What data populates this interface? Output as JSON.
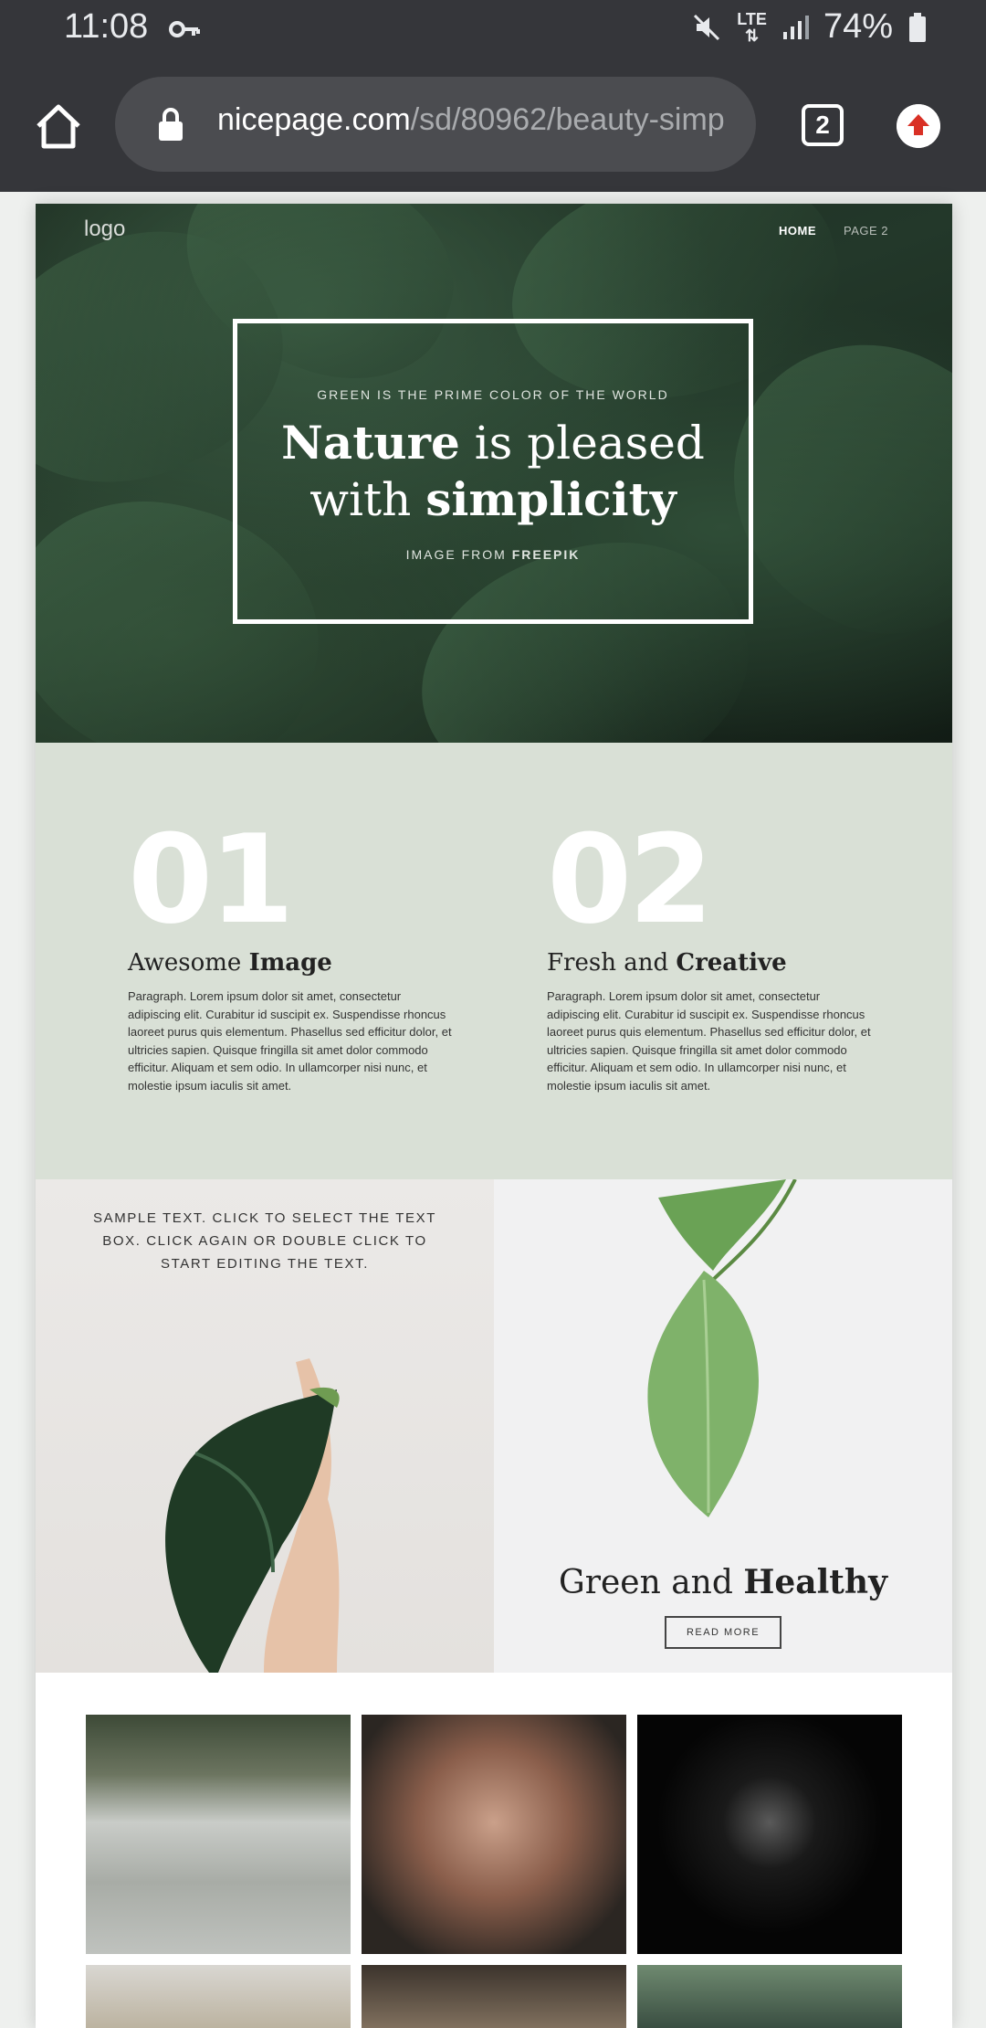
{
  "status_bar": {
    "time": "11:08",
    "network": "LTE",
    "battery": "74%",
    "icons": [
      "key-icon",
      "mute-icon",
      "signal-icon",
      "battery-icon"
    ]
  },
  "browser": {
    "url_host": "nicepage.com",
    "url_path": "/sd/80962/beauty-simp",
    "tab_count": "2",
    "icons": [
      "home-icon",
      "lock-icon",
      "tabs-icon",
      "update-icon"
    ]
  },
  "site": {
    "logo": "logo",
    "nav": {
      "home": "HOME",
      "page2": "PAGE 2"
    },
    "hero": {
      "kicker": "GREEN IS THE PRIME COLOR OF THE WORLD",
      "title_word1_bold": "Nature",
      "title_line1_rest": " is pleased",
      "title_line2_start": "with ",
      "title_word2_bold": "simplicity",
      "credit_prefix": "IMAGE FROM ",
      "credit_bold": "FREEPIK"
    },
    "features": [
      {
        "number": "01",
        "title_plain": "Awesome ",
        "title_bold": "Image",
        "body": "Paragraph. Lorem ipsum dolor sit amet, consectetur adipiscing elit. Curabitur id suscipit ex. Suspendisse rhoncus laoreet purus quis elementum. Phasellus sed efficitur dolor, et ultricies sapien. Quisque fringilla sit amet dolor commodo efficitur. Aliquam et sem odio. In ullamcorper nisi nunc, et molestie ipsum iaculis sit amet."
      },
      {
        "number": "02",
        "title_plain": "Fresh and ",
        "title_bold": "Creative",
        "body": "Paragraph. Lorem ipsum dolor sit amet, consectetur adipiscing elit. Curabitur id suscipit ex. Suspendisse rhoncus laoreet purus quis elementum. Phasellus sed efficitur dolor, et ultricies sapien. Quisque fringilla sit amet dolor commodo efficitur. Aliquam et sem odio. In ullamcorper nisi nunc, et molestie ipsum iaculis sit amet."
      }
    ],
    "split": {
      "sample_text": "SAMPLE TEXT. CLICK TO SELECT THE TEXT BOX. CLICK AGAIN OR DOUBLE CLICK TO START EDITING THE TEXT.",
      "title_plain": "Green and ",
      "title_bold": "Healthy",
      "button": "READ MORE"
    }
  },
  "colors": {
    "chrome_bg": "#35363a",
    "omnibox_bg": "#4b4c50",
    "features_bg": "#d9e0d6",
    "update_red": "#d93025"
  }
}
